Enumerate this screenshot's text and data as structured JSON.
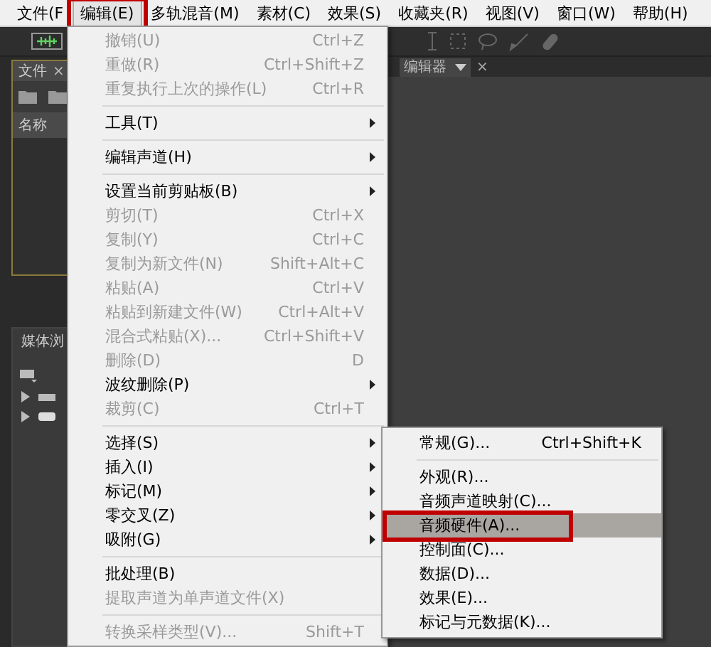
{
  "menu_bar": [
    {
      "label": "文件(F",
      "selected": false,
      "annotated": false
    },
    {
      "label": "编辑(E)",
      "selected": true,
      "annotated": true
    },
    {
      "label": "多轨混音(M)",
      "selected": false,
      "annotated": false
    },
    {
      "label": "素材(C)",
      "selected": false,
      "annotated": false
    },
    {
      "label": "效果(S)",
      "selected": false,
      "annotated": false
    },
    {
      "label": "收藏夹(R)",
      "selected": false,
      "annotated": false
    },
    {
      "label": "视图(V)",
      "selected": false,
      "annotated": false
    },
    {
      "label": "窗口(W)",
      "selected": false,
      "annotated": false
    },
    {
      "label": "帮助(H)",
      "selected": false,
      "annotated": false
    }
  ],
  "files_panel": {
    "tab": "文件",
    "close": "×",
    "column": "名称"
  },
  "media_panel": {
    "tab": "媒体浏"
  },
  "editor_panel": {
    "tab": "编辑器",
    "close": "×"
  },
  "edit_menu": {
    "items": [
      {
        "kind": "item",
        "label": "撤销(U)",
        "shortcut": "Ctrl+Z",
        "disabled": true,
        "submenu": false
      },
      {
        "kind": "item",
        "label": "重做(R)",
        "shortcut": "Ctrl+Shift+Z",
        "disabled": true,
        "submenu": false
      },
      {
        "kind": "item",
        "label": "重复执行上次的操作(L)",
        "shortcut": "Ctrl+R",
        "disabled": true,
        "submenu": false
      },
      {
        "kind": "separator"
      },
      {
        "kind": "item",
        "label": "工具(T)",
        "disabled": false,
        "submenu": true
      },
      {
        "kind": "separator"
      },
      {
        "kind": "item",
        "label": "编辑声道(H)",
        "disabled": false,
        "submenu": true
      },
      {
        "kind": "separator"
      },
      {
        "kind": "item",
        "label": "设置当前剪贴板(B)",
        "disabled": false,
        "submenu": true
      },
      {
        "kind": "item",
        "label": "剪切(T)",
        "shortcut": "Ctrl+X",
        "disabled": true,
        "submenu": false
      },
      {
        "kind": "item",
        "label": "复制(Y)",
        "shortcut": "Ctrl+C",
        "disabled": true,
        "submenu": false
      },
      {
        "kind": "item",
        "label": "复制为新文件(N)",
        "shortcut": "Shift+Alt+C",
        "disabled": true,
        "submenu": false
      },
      {
        "kind": "item",
        "label": "粘贴(A)",
        "shortcut": "Ctrl+V",
        "disabled": true,
        "submenu": false
      },
      {
        "kind": "item",
        "label": "粘贴到新建文件(W)",
        "shortcut": "Ctrl+Alt+V",
        "disabled": true,
        "submenu": false
      },
      {
        "kind": "item",
        "label": "混合式粘贴(X)...",
        "shortcut": "Ctrl+Shift+V",
        "disabled": true,
        "submenu": false
      },
      {
        "kind": "item",
        "label": "删除(D)",
        "shortcut": "D",
        "disabled": true,
        "submenu": false
      },
      {
        "kind": "item",
        "label": "波纹删除(P)",
        "disabled": false,
        "submenu": true
      },
      {
        "kind": "item",
        "label": "裁剪(C)",
        "shortcut": "Ctrl+T",
        "disabled": true,
        "submenu": false
      },
      {
        "kind": "separator"
      },
      {
        "kind": "item",
        "label": "选择(S)",
        "disabled": false,
        "submenu": true
      },
      {
        "kind": "item",
        "label": "插入(I)",
        "disabled": false,
        "submenu": true
      },
      {
        "kind": "item",
        "label": "标记(M)",
        "disabled": false,
        "submenu": true
      },
      {
        "kind": "item",
        "label": "零交叉(Z)",
        "disabled": false,
        "submenu": true
      },
      {
        "kind": "item",
        "label": "吸附(G)",
        "disabled": false,
        "submenu": true
      },
      {
        "kind": "separator"
      },
      {
        "kind": "item",
        "label": "批处理(B)",
        "disabled": false,
        "submenu": false
      },
      {
        "kind": "item",
        "label": "提取声道为单声道文件(X)",
        "disabled": true,
        "submenu": false
      },
      {
        "kind": "separator"
      },
      {
        "kind": "item",
        "label": "转换采样类型(V)...",
        "shortcut": "Shift+T",
        "disabled": true,
        "submenu": false
      }
    ]
  },
  "preferences_submenu": {
    "items": [
      {
        "kind": "item",
        "label": "常规(G)...",
        "shortcut": "Ctrl+Shift+K",
        "selected": false,
        "annotated": false
      },
      {
        "kind": "separator"
      },
      {
        "kind": "item",
        "label": "外观(R)...",
        "selected": false,
        "annotated": false
      },
      {
        "kind": "item",
        "label": "音频声道映射(C)...",
        "selected": false,
        "annotated": false
      },
      {
        "kind": "item",
        "label": "音频硬件(A)...",
        "selected": true,
        "annotated": true
      },
      {
        "kind": "item",
        "label": "控制面(C)...",
        "selected": false,
        "annotated": false
      },
      {
        "kind": "item",
        "label": "数据(D)...",
        "selected": false,
        "annotated": false
      },
      {
        "kind": "item",
        "label": "效果(E)...",
        "selected": false,
        "annotated": false
      },
      {
        "kind": "item",
        "label": "标记与元数据(K)...",
        "selected": false,
        "annotated": false
      }
    ]
  }
}
